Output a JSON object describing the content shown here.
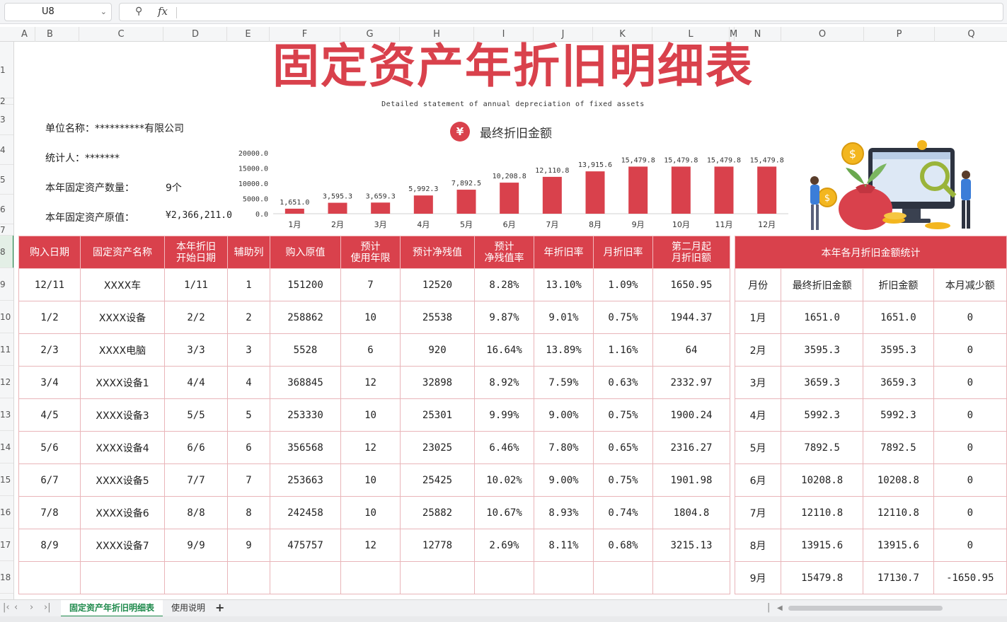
{
  "formula_bar": {
    "name_box": "U8",
    "fx_label": "fx",
    "formula_value": ""
  },
  "columns": [
    "A",
    "B",
    "C",
    "D",
    "E",
    "F",
    "G",
    "H",
    "I",
    "J",
    "K",
    "L",
    "M",
    "N",
    "O",
    "P",
    "Q"
  ],
  "rows": [
    "1",
    "2",
    "3",
    "4",
    "5",
    "6",
    "7",
    "8",
    "9",
    "10",
    "11",
    "12",
    "13",
    "14",
    "15",
    "16",
    "17",
    "18"
  ],
  "title": "固定资产年折旧明细表",
  "subtitle": "Detailed statement of annual depreciation of fixed assets",
  "info": [
    {
      "label": "单位名称：**********有限公司",
      "value": ""
    },
    {
      "label": "统计人：*******",
      "value": ""
    },
    {
      "label": "本年固定资产数量：",
      "value": "9个"
    },
    {
      "label": "本年固定资产原值：",
      "value": "¥2,366,211.0"
    }
  ],
  "chart_title": "最终折旧金额",
  "chart_data": {
    "type": "bar",
    "title": "最终折旧金额",
    "categories": [
      "1月",
      "2月",
      "3月",
      "4月",
      "5月",
      "6月",
      "7月",
      "8月",
      "9月",
      "10月",
      "11月",
      "12月"
    ],
    "values": [
      1651.0,
      3595.3,
      3659.3,
      5992.3,
      7892.5,
      10208.8,
      12110.8,
      13915.6,
      15479.8,
      15479.8,
      15479.8,
      15479.8
    ],
    "value_labels": [
      "1,651.0",
      "3,595.3",
      "3,659.3",
      "5,992.3",
      "7,892.5",
      "10,208.8",
      "12,110.8",
      "13,915.6",
      "15,479.8",
      "15,479.8",
      "15,479.8",
      "15,479.8"
    ],
    "y_ticks": [
      "20000.0",
      "15000.0",
      "10000.0",
      "5000.0",
      "0.0"
    ],
    "ylim": [
      0,
      20000
    ],
    "color": "#d9414c",
    "grid": false,
    "legend": "none"
  },
  "main_table": {
    "headers": [
      [
        "购入日期"
      ],
      [
        "固定资产名称"
      ],
      [
        "本年折旧",
        "开始日期"
      ],
      [
        "辅助列"
      ],
      [
        "购入原值"
      ],
      [
        "预计",
        "使用年限"
      ],
      [
        "预计净残值"
      ],
      [
        "预计",
        "净残值率"
      ],
      [
        "年折旧率"
      ],
      [
        "月折旧率"
      ],
      [
        "第二月起",
        "月折旧额"
      ]
    ],
    "rows": [
      [
        "12/11",
        "XXXX车",
        "1/11",
        "1",
        "151200",
        "7",
        "12520",
        "8.28%",
        "13.10%",
        "1.09%",
        "1650.95"
      ],
      [
        "1/2",
        "XXXX设备",
        "2/2",
        "2",
        "258862",
        "10",
        "25538",
        "9.87%",
        "9.01%",
        "0.75%",
        "1944.37"
      ],
      [
        "2/3",
        "XXXX电脑",
        "3/3",
        "3",
        "5528",
        "6",
        "920",
        "16.64%",
        "13.89%",
        "1.16%",
        "64"
      ],
      [
        "3/4",
        "XXXX设备1",
        "4/4",
        "4",
        "368845",
        "12",
        "32898",
        "8.92%",
        "7.59%",
        "0.63%",
        "2332.97"
      ],
      [
        "4/5",
        "XXXX设备3",
        "5/5",
        "5",
        "253330",
        "10",
        "25301",
        "9.99%",
        "9.00%",
        "0.75%",
        "1900.24"
      ],
      [
        "5/6",
        "XXXX设备4",
        "6/6",
        "6",
        "356568",
        "12",
        "23025",
        "6.46%",
        "7.80%",
        "0.65%",
        "2316.27"
      ],
      [
        "6/7",
        "XXXX设备5",
        "7/7",
        "7",
        "253663",
        "10",
        "25425",
        "10.02%",
        "9.00%",
        "0.75%",
        "1901.98"
      ],
      [
        "7/8",
        "XXXX设备6",
        "8/8",
        "8",
        "242458",
        "10",
        "25882",
        "10.67%",
        "8.93%",
        "0.74%",
        "1804.8"
      ],
      [
        "8/9",
        "XXXX设备7",
        "9/9",
        "9",
        "475757",
        "12",
        "12778",
        "2.69%",
        "8.11%",
        "0.68%",
        "3215.13"
      ],
      [
        "",
        "",
        "",
        "",
        "",
        "",
        "",
        "",
        "",
        "",
        ""
      ]
    ]
  },
  "side_table": {
    "title": "本年各月折旧金额统计",
    "headers": [
      "月份",
      "最终折旧金额",
      "折旧金额",
      "本月减少额"
    ],
    "rows": [
      [
        "1月",
        "1651.0",
        "1651.0",
        "0"
      ],
      [
        "2月",
        "3595.3",
        "3595.3",
        "0"
      ],
      [
        "3月",
        "3659.3",
        "3659.3",
        "0"
      ],
      [
        "4月",
        "5992.3",
        "5992.3",
        "0"
      ],
      [
        "5月",
        "7892.5",
        "7892.5",
        "0"
      ],
      [
        "6月",
        "10208.8",
        "10208.8",
        "0"
      ],
      [
        "7月",
        "12110.8",
        "12110.8",
        "0"
      ],
      [
        "8月",
        "13915.6",
        "13915.6",
        "0"
      ],
      [
        "9月",
        "15479.8",
        "17130.7",
        "-1650.95"
      ]
    ]
  },
  "sheet_tabs": {
    "active": "固定资产年折旧明细表",
    "other": "使用说明",
    "add": "+"
  },
  "colors": {
    "accent": "#d9414c",
    "sheet_green": "#1f8a4c"
  },
  "icons": [
    "zoom-icon",
    "yen-icon",
    "money-plant-illustration",
    "monitor-illustration",
    "magnifier-illustration",
    "coin-icon"
  ]
}
